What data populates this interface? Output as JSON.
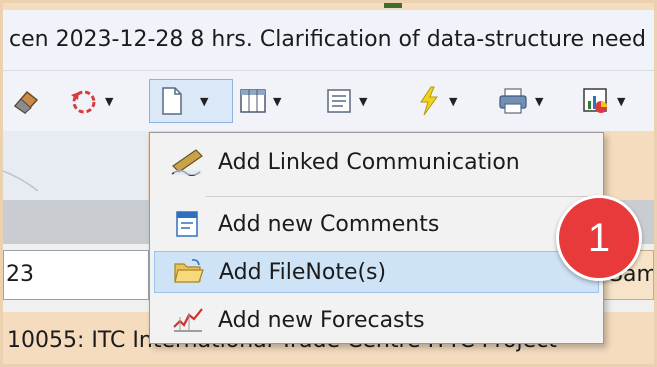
{
  "title_bar": {
    "text": "cen 2023-12-28 8 hrs. Clarification of data-structure need"
  },
  "toolbar": {
    "buttons": [
      {
        "icon": "eraser-icon"
      },
      {
        "icon": "undo-refresh-icon"
      },
      {
        "icon": "document-icon"
      },
      {
        "icon": "table-icon"
      },
      {
        "icon": "list-icon"
      },
      {
        "icon": "lightning-icon"
      },
      {
        "icon": "printer-icon"
      },
      {
        "icon": "chart-export-icon"
      }
    ]
  },
  "context_menu": {
    "items": [
      {
        "label": "Add Linked Communication",
        "icon": "pen-signature-icon",
        "highlighted": false
      },
      {
        "label": "Add new Comments",
        "icon": "comment-note-icon",
        "highlighted": false
      },
      {
        "label": "Add FileNote(s)",
        "icon": "open-folder-icon",
        "highlighted": true
      },
      {
        "label": "Add new Forecasts",
        "icon": "forecast-chart-icon",
        "highlighted": false
      }
    ]
  },
  "input_field": {
    "value": "23"
  },
  "right_button": {
    "label": "Sam"
  },
  "bottom_text": "10055: ITC International Trade Centre ITTC Project",
  "badge": {
    "number": "1",
    "color": "#e8393b"
  },
  "colors": {
    "menu_highlight": "#cfe3f7",
    "background": "#f5dcbf"
  }
}
